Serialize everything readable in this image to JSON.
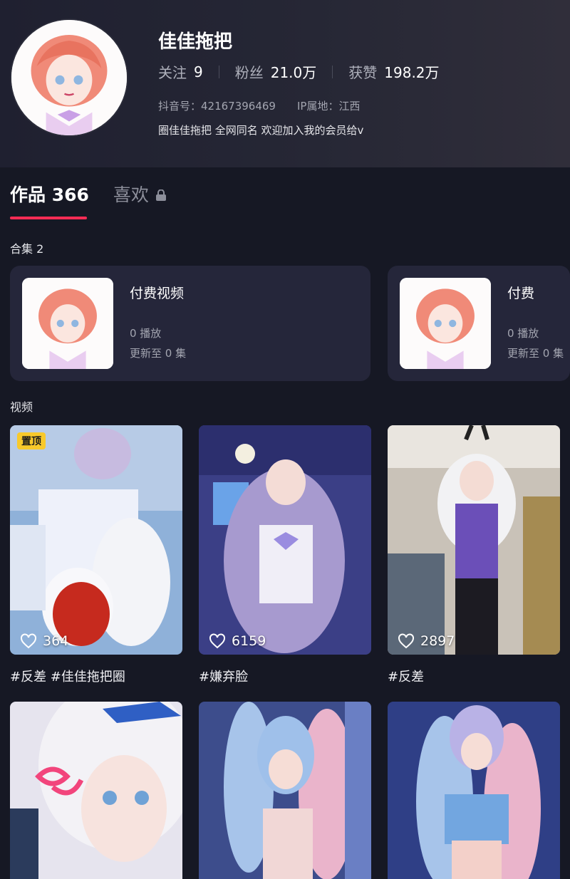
{
  "profile": {
    "name": "佳佳拖把",
    "stats": [
      {
        "label": "关注",
        "value": "9"
      },
      {
        "label": "粉丝",
        "value": "21.0万"
      },
      {
        "label": "获赞",
        "value": "198.2万"
      }
    ],
    "douyin_id": "抖音号：42167396469",
    "ip_location": "IP属地：江西",
    "bio": "圈佳佳拖把 全网同名 欢迎加入我的会员给v"
  },
  "tabs": {
    "works_label": "作品 366",
    "liked_label": "喜欢",
    "liked_icon": "lock-icon"
  },
  "collections": {
    "title": "合集 2",
    "items": [
      {
        "title": "付费视频",
        "plays": "0 播放",
        "update": "更新至 0 集"
      },
      {
        "title": "付费",
        "plays": "0 播放",
        "update": "更新至 0 集"
      }
    ]
  },
  "videos": {
    "title": "视频",
    "items": [
      {
        "pinned_label": "置顶",
        "likes": "364",
        "caption": "#反差 #佳佳拖把圈"
      },
      {
        "likes": "6159",
        "caption": "#嫌弃脸"
      },
      {
        "likes": "2897",
        "caption": "#反差"
      },
      {},
      {},
      {}
    ]
  },
  "colors": {
    "background": "#161824",
    "accent": "#ff2c55",
    "card": "#25263a",
    "pin": "#f8c92b"
  }
}
